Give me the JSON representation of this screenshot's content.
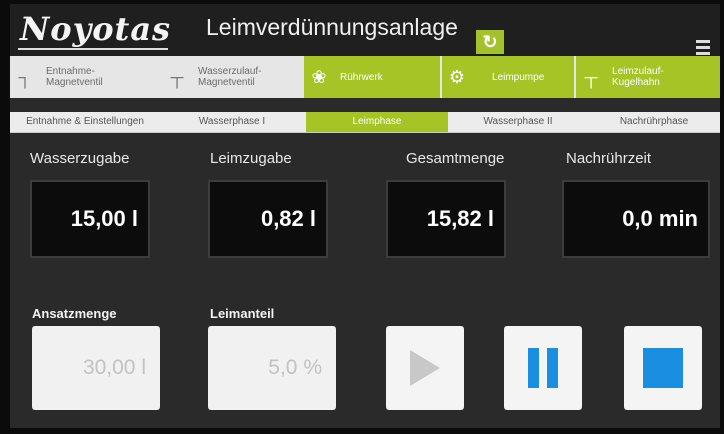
{
  "header": {
    "logo_text": "Noyotas",
    "title": "Leimverdünnungsanlage",
    "refresh_icon": "refresh-icon",
    "menu_icon": "menu-icon"
  },
  "components": [
    {
      "label_1": "Entnahme-",
      "label_2": "Magnetventil",
      "icon": "valve-icon",
      "active": false
    },
    {
      "label_1": "Wasserzulauf-",
      "label_2": "Magnetventil",
      "icon": "pipe-valve-icon",
      "active": false
    },
    {
      "label_1": "Rührwerk",
      "label_2": "",
      "icon": "fan-icon",
      "active": true
    },
    {
      "label_1": "Leimpumpe",
      "label_2": "",
      "icon": "pump-icon",
      "active": true
    },
    {
      "label_1": "Leimzulauf-",
      "label_2": "Kugelhahn",
      "icon": "ball-valve-icon",
      "active": true
    }
  ],
  "phase_tabs": [
    {
      "label": "Entnahme & Einstellungen",
      "active": false
    },
    {
      "label": "Wasserphase I",
      "active": false
    },
    {
      "label": "Leimphase",
      "active": true
    },
    {
      "label": "Wasserphase II",
      "active": false
    },
    {
      "label": "Nachrührphase",
      "active": false
    }
  ],
  "values": {
    "wasserzugabe": {
      "label": "Wasserzugabe",
      "value": "15,00 l"
    },
    "leimzugabe": {
      "label": "Leimzugabe",
      "value": "0,82 l"
    },
    "gesamtmenge": {
      "label": "Gesamtmenge",
      "value": "15,82 l"
    },
    "nachruehrzeit": {
      "label": "Nachrührzeit",
      "value": "0,0 min"
    }
  },
  "settings": {
    "ansatzmenge": {
      "label": "Ansatzmenge",
      "value": "30,00 l"
    },
    "leimanteil": {
      "label": "Leimanteil",
      "value": "5,0 %"
    }
  },
  "controls": {
    "play_icon": "play-icon",
    "pause_icon": "pause-icon",
    "stop_icon": "stop-icon"
  },
  "colors": {
    "accent_green": "#a6c425",
    "control_blue": "#1a8ee0"
  }
}
